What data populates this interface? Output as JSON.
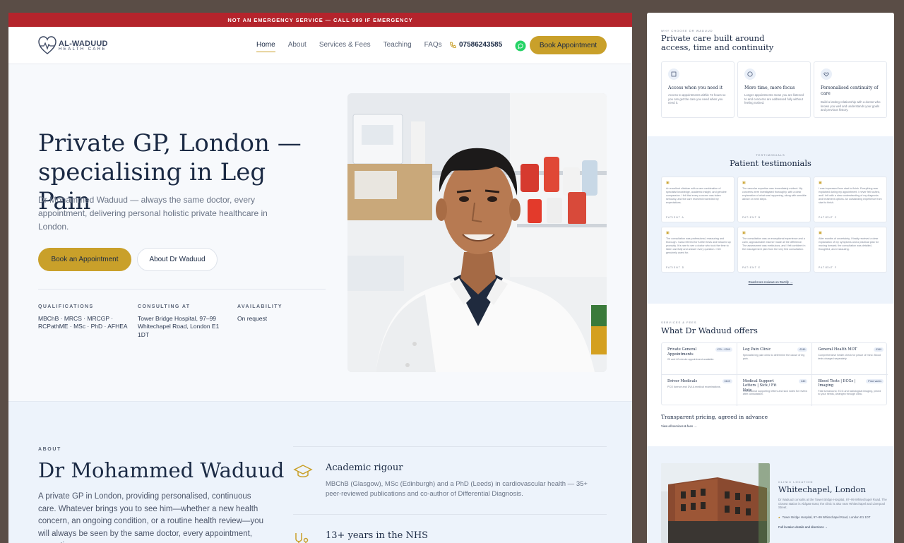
{
  "banner": "NOT AN EMERGENCY SERVICE — CALL 999 IF EMERGENCY",
  "logo": {
    "line1": "AL-WADUUD",
    "line2": "HEALTH CARE"
  },
  "nav": {
    "items": [
      "Home",
      "About",
      "Services & Fees",
      "Teaching",
      "FAQs"
    ],
    "phone": "07586243585",
    "book": "Book Appointment"
  },
  "hero": {
    "title": "Private GP, London — specialising in Leg Pain",
    "subtitle": "Dr Mohammed Waduud — always the same doctor, every appointment, delivering personal holistic private healthcare in London.",
    "book_btn": "Book an Appointment",
    "about_btn": "About Dr Waduud",
    "meta": [
      {
        "h": "QUALIFICATIONS",
        "v": "MBChB · MRCS · MRCGP · RCPathME · MSc · PhD · AFHEA"
      },
      {
        "h": "CONSULTING AT",
        "v": "Tower Bridge Hospital, 97–99 Whitechapel Road, London E1 1DT"
      },
      {
        "h": "AVAILABILITY",
        "v": "On request"
      }
    ]
  },
  "about": {
    "tag": "ABOUT",
    "title": "Dr Mohammed Waduud",
    "text": "A private GP in London, providing personalised, continuous care. Whatever brings you to see him—whether a new health concern, an ongoing condition, or a routine health review—you will always be seen by the same doctor, every appointment, every time.",
    "features": [
      {
        "t": "Academic rigour",
        "d": "MBChB (Glasgow), MSc (Edinburgh) and a PhD (Leeds) in cardiovascular health — 35+ peer-reviewed publications and co-author of Differential Diagnosis."
      },
      {
        "t": "13+ years in the NHS",
        "d": ""
      }
    ]
  },
  "side": {
    "why": {
      "tag": "WHY CHOOSE DR WADUUD",
      "title": "Private care built around access, time and continuity",
      "cards": [
        {
          "t": "Access when you need it",
          "d": "Access to appointments within 72 hours so you can get the care you need when you need it."
        },
        {
          "t": "More time, more focus",
          "d": "Longer appointments mean you are listened to and concerns are addressed fully without feeling rushed."
        },
        {
          "t": "Personalised continuity of care",
          "d": "Build a lasting relationship with a doctor who knows you well and understands your goals and previous history."
        }
      ]
    },
    "test": {
      "tag": "TESTIMONIALS",
      "title": "Patient testimonials",
      "items": [
        {
          "q": "An excellent clinician with a rare combination of specialist knowledge, academic insight, and genuine compassion. I felt that every concern was taken seriously, and the care received exceeded my expectations.",
          "a": "PATIENT A"
        },
        {
          "q": "The vascular expertise was immediately evident. My concerns were investigated thoroughly, with a clear explanation of what was happening, along with sensible advice on next steps.",
          "a": "PATIENT B"
        },
        {
          "q": "I was impressed from start to finish. Everything was explained during my appointment. I never felt rushed, and I left with a clear understanding of my diagnosis and treatment options. An outstanding experience from start to finish.",
          "a": "PATIENT C"
        },
        {
          "q": "The consultation was professional, reassuring and thorough. I was referred for further tests and followed up promptly. It is rare to see a doctor who took the time to listen carefully and answer every question. I felt genuinely cared for.",
          "a": "PATIENT D"
        },
        {
          "q": "The consultation was an exceptional experience and a calm, approachable manner made all the difference. The assessment was meticulous, and I felt confident in the management plan from the very first consultation.",
          "a": "PATIENT E"
        },
        {
          "q": "After months of uncertainty, I finally received a clear explanation of my symptoms and a practical plan for moving forward; the consultation was detailed, thoughtful, and reassuring.",
          "a": "PATIENT F"
        }
      ],
      "more": "Read more reviews on Doctify →"
    },
    "offers": {
      "tag": "SERVICES & FEES",
      "title": "What Dr Waduud offers",
      "items": [
        {
          "t": "Private General Appointments",
          "p": "£79 – £249",
          "d": "20 and 40 minute appointment available."
        },
        {
          "t": "Leg Pain Clinic",
          "p": "£249",
          "d": "Specialist leg pain clinic to determine the cause of leg pain."
        },
        {
          "t": "General Health MOT",
          "p": "£349",
          "d": "Comprehensive health check for peace of mind. Blood tests charged separately."
        },
        {
          "t": "Driver Medicals",
          "p": "£149",
          "d": "PCO licence and DVLA medical examinations."
        },
        {
          "t": "Medical Support Letters | Sick / Fit Note",
          "p": "£40",
          "d": "Professional supporting letters and sick notes for review after consultation."
        },
        {
          "t": "Blood Tests | ECGs | Imaging",
          "p": "Price varies",
          "d": "Fast turnaround, ECG and radiological imaging, priced to your needs, arranged through clinic."
        }
      ],
      "footer": "Transparent pricing, agreed in advance",
      "link": "View all services & fees →"
    },
    "clinic": {
      "tag": "CLINIC LOCATION",
      "title": "Whitechapel, London",
      "d": "Dr Waduud consults at the Tower Bridge Hospital, 97–99 Whitechapel Road. The closest station is Aldgate East; the clinic is also near Whitechapel and Liverpool Street.",
      "addr": "Tower Bridge Hospital, 97–99 Whitechapel Road, London E1 1DT",
      "link": "Full location details and directions →"
    }
  },
  "colors": {
    "accent": "#c9a02a",
    "banner": "#b4242c",
    "navy": "#1b2a44"
  }
}
